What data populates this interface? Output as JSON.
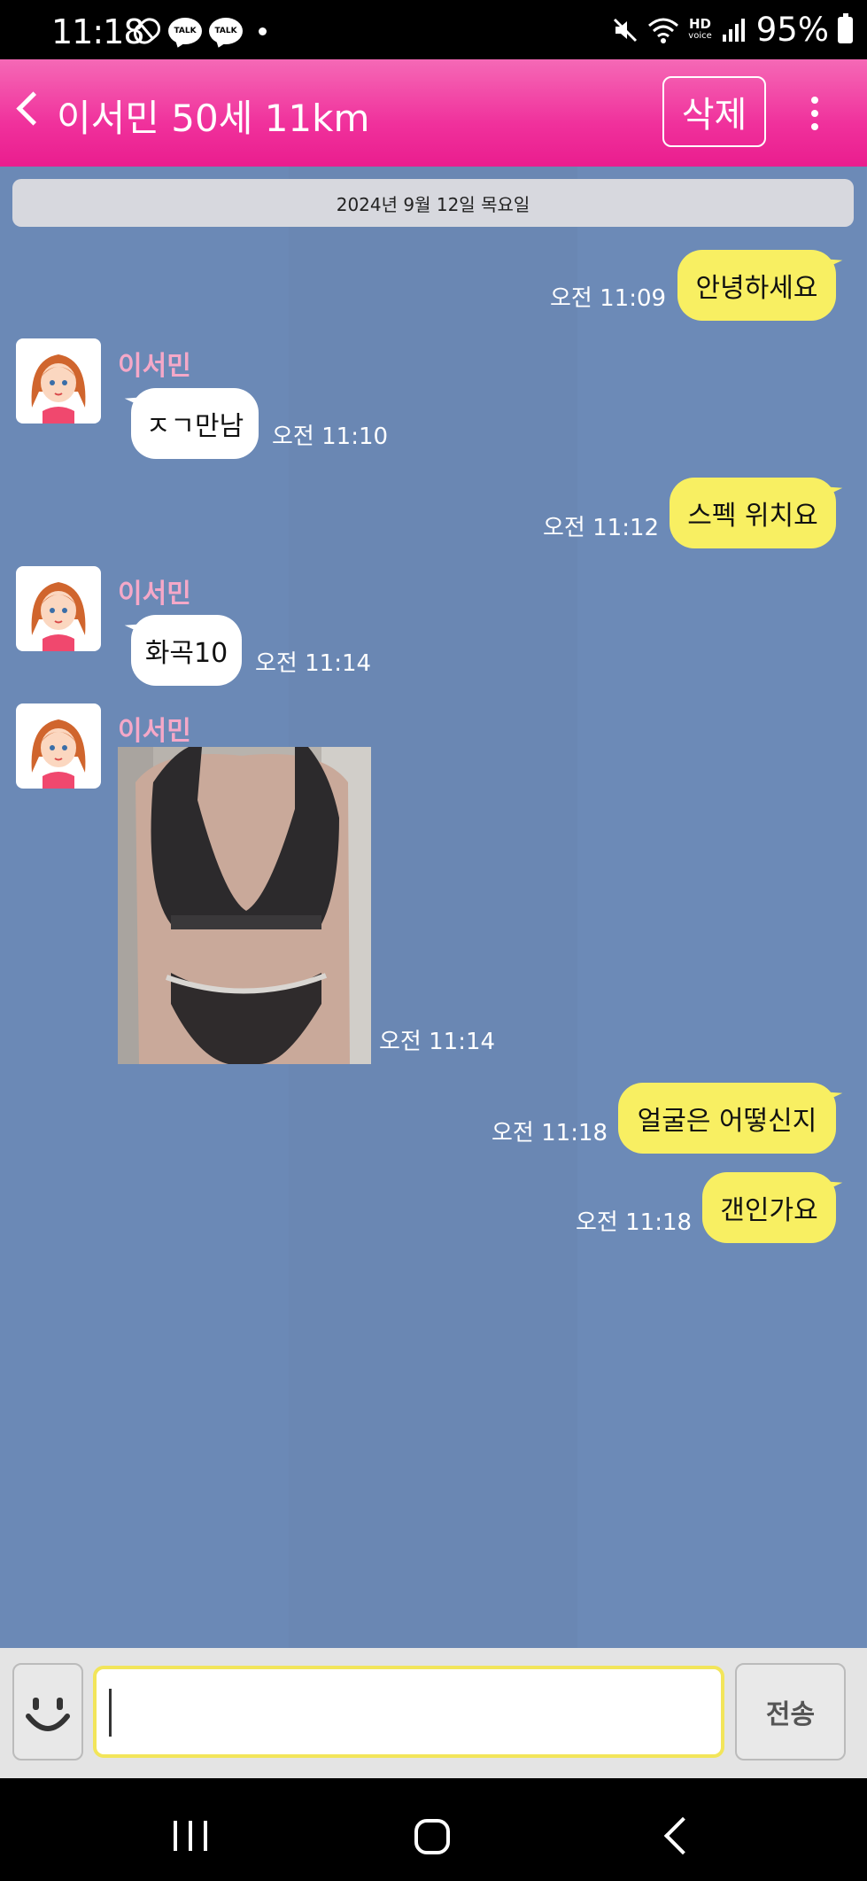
{
  "status_bar": {
    "time": "11:18",
    "notification_icons": [
      "pill-icon",
      "kakaotalk-icon",
      "kakaotalk-icon",
      "dot-icon"
    ],
    "talk_label": "TALK",
    "battery": "95%",
    "hd_label": "HD",
    "voice_label": "voice"
  },
  "header": {
    "title": "이서민 50세 11km",
    "delete_label": "삭제",
    "color": "#f0319c"
  },
  "chat": {
    "date": "2024년 9월 12일 목요일",
    "background": "#6e8cb9",
    "outgoing_color": "#f8ef62",
    "messages": [
      {
        "direction": "out",
        "text": "안녕하세요",
        "time": "오전 11:09"
      },
      {
        "direction": "in",
        "sender": "이서민",
        "text": "ㅈㄱ만남",
        "time": "오전 11:10"
      },
      {
        "direction": "out",
        "text": "스펙 위치요",
        "time": "오전 11:12"
      },
      {
        "direction": "in",
        "sender": "이서민",
        "text": "화곡10",
        "time": "오전 11:14"
      },
      {
        "direction": "in",
        "sender": "이서민",
        "type": "photo",
        "time": "오전 11:14"
      },
      {
        "direction": "out",
        "text": "얼굴은 어떻신지",
        "time": "오전 11:18"
      },
      {
        "direction": "out",
        "text": "갠인가요",
        "time": "오전 11:18"
      }
    ]
  },
  "input_bar": {
    "send_label": "전송",
    "input_value": "",
    "input_placeholder": ""
  }
}
